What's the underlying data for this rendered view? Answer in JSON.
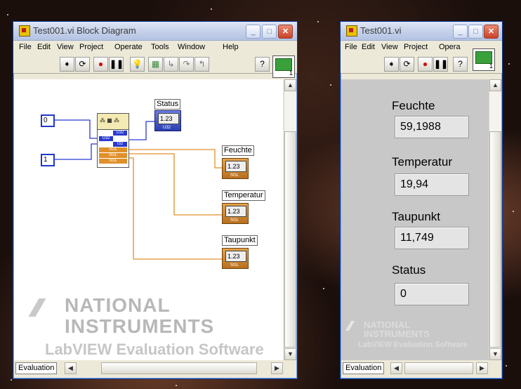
{
  "block_diagram": {
    "title": "Test001.vi Block Diagram",
    "menu": [
      "File",
      "Edit",
      "View",
      "Project",
      "Operate",
      "Tools",
      "Window",
      "Help"
    ],
    "constants": [
      "0",
      "1"
    ],
    "indicators": [
      {
        "label": "Status",
        "display": "1.23",
        "type": "U32"
      },
      {
        "label": "Feuchte",
        "display": "1.23",
        "type": "SGL"
      },
      {
        "label": "Temperatur",
        "display": "1.23",
        "type": "SGL"
      },
      {
        "label": "Taupunkt",
        "display": "1.23",
        "type": "SGL"
      }
    ],
    "subvi_terminals": [
      "U32",
      "U32",
      "I32",
      "SGL",
      "SGL",
      "SGL"
    ],
    "watermark": {
      "line1": "NATIONAL",
      "line2": "INSTRUMENTS",
      "line3": "LabVIEW Evaluation Software"
    },
    "status_label": "Evaluation"
  },
  "front_panel": {
    "title": "Test001.vi",
    "menu": [
      "File",
      "Edit",
      "View",
      "Project",
      "Opera"
    ],
    "fields": [
      {
        "label": "Feuchte",
        "value": "59,1988"
      },
      {
        "label": "Temperatur",
        "value": "19,94"
      },
      {
        "label": "Taupunkt",
        "value": "11,749"
      },
      {
        "label": "Status",
        "value": "0"
      }
    ],
    "watermark": {
      "line1": "NATIONAL",
      "line2": "INSTRUMENTS",
      "line3": "LabVIEW Evaluation Software"
    },
    "status_label": "Evaluation"
  },
  "icons": [
    "run-arrow-icon",
    "run-continuous-icon",
    "abort-icon",
    "pause-icon",
    "highlight-bulb-icon",
    "help-icon",
    "vi-connector-icon"
  ],
  "colors": {
    "sgl_wire": "#e0902a",
    "int_wire": "#2a3ad0",
    "panel_bg": "#c8c8c8"
  }
}
